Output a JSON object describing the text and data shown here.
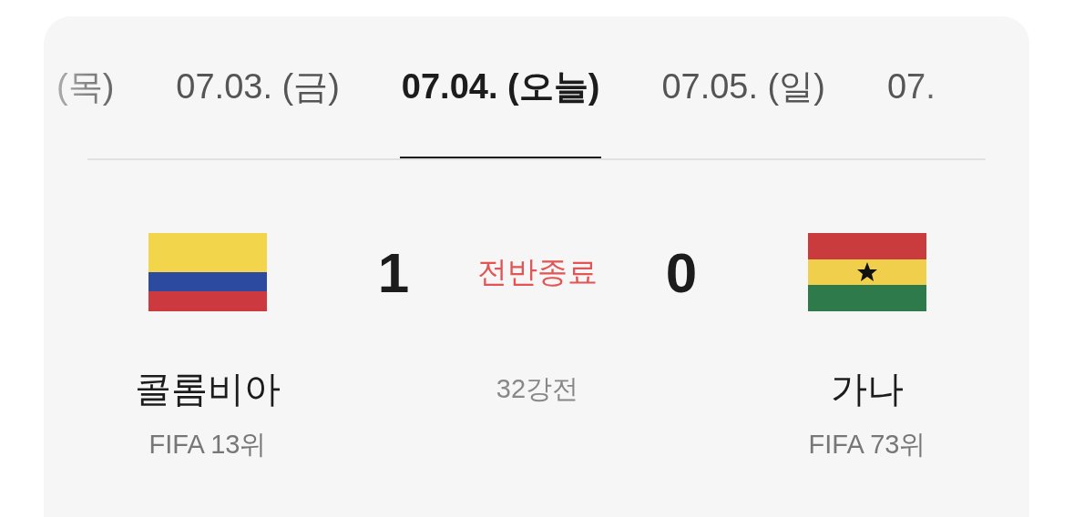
{
  "date_tabs": [
    {
      "label": "(목)",
      "selected": false
    },
    {
      "label": "07.03. (금)",
      "selected": false
    },
    {
      "label": "07.04. (오늘)",
      "selected": true
    },
    {
      "label": "07.05. (일)",
      "selected": false
    },
    {
      "label": "07.",
      "selected": false
    }
  ],
  "match": {
    "status": "전반종료",
    "round": "32강전",
    "home": {
      "flag": {
        "kind": "colombia"
      },
      "score": "1",
      "name": "콜롬비아",
      "rank": "FIFA 13위"
    },
    "away": {
      "flag": {
        "kind": "ghana"
      },
      "score": "0",
      "name": "가나",
      "rank": "FIFA 73위"
    }
  }
}
